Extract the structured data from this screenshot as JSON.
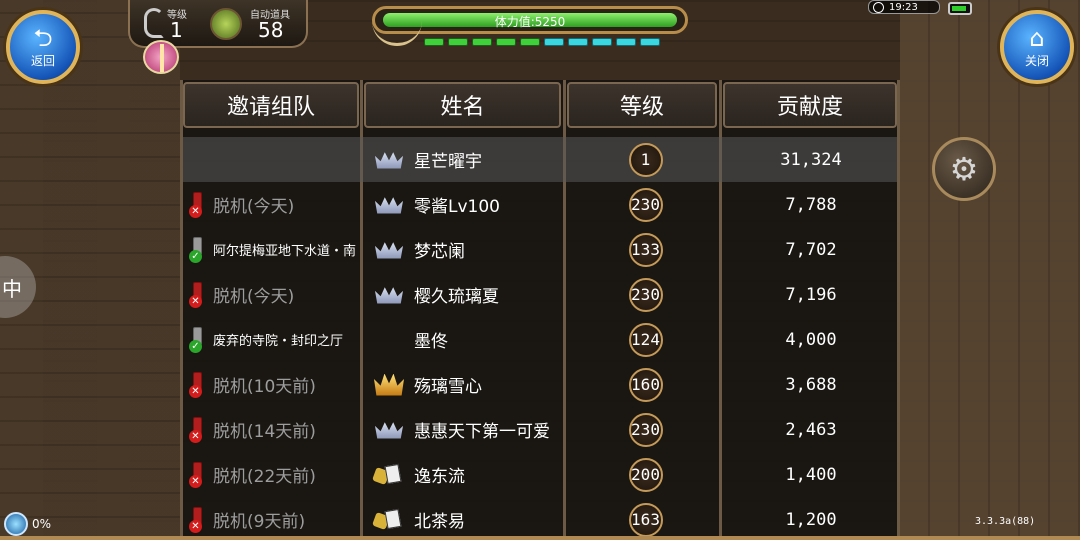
{
  "hud": {
    "level_label": "等级",
    "level_value": "1",
    "auto_item_label": "自动道具",
    "auto_item_value": "58",
    "stamina_text": "体力值:5250",
    "stamina_percent": 100,
    "energy_segments": {
      "green": 5,
      "cyan": 5
    },
    "clock": "19:23"
  },
  "buttons": {
    "back_label": "返回",
    "back_icon": "return-arrow-icon",
    "close_label": "关闭",
    "close_icon": "home-icon",
    "settings_icon": "gear-icon",
    "side_tab_glyph": "中"
  },
  "table": {
    "headers": {
      "status": "邀请组队",
      "name": "姓名",
      "level": "等级",
      "contribution": "贡献度"
    },
    "rows": [
      {
        "status": "",
        "online": null,
        "rank": "silver-crown-icon",
        "name": "星芒曜宇",
        "level": "1",
        "contribution": "31,324",
        "highlight": true
      },
      {
        "status": "脱机(今天)",
        "online": false,
        "rank": "silver-crown-icon",
        "name": "零酱Lv100",
        "level": "230",
        "contribution": "7,788"
      },
      {
        "status": "阿尔提梅亚地下水道・南",
        "online": true,
        "rank": "silver-crown-icon",
        "name": "梦芯阑",
        "level": "133",
        "contribution": "7,702"
      },
      {
        "status": "脱机(今天)",
        "online": false,
        "rank": "silver-crown-icon",
        "name": "樱久琉璃夏",
        "level": "230",
        "contribution": "7,196"
      },
      {
        "status": "废弃的寺院・封印之厅",
        "online": true,
        "rank": "",
        "name": "墨佟",
        "level": "124",
        "contribution": "4,000"
      },
      {
        "status": "脱机(10天前)",
        "online": false,
        "rank": "gold-crown-icon",
        "name": "殇璃雪心",
        "level": "160",
        "contribution": "3,688"
      },
      {
        "status": "脱机(14天前)",
        "online": false,
        "rank": "silver-crown-icon",
        "name": "惠惠天下第一可爱",
        "level": "230",
        "contribution": "2,463"
      },
      {
        "status": "脱机(22天前)",
        "online": false,
        "rank": "tools-icon",
        "name": "逸东流",
        "level": "200",
        "contribution": "1,400"
      },
      {
        "status": "脱机(9天前)",
        "online": false,
        "rank": "tools-icon",
        "name": "北茶易",
        "level": "163",
        "contribution": "1,200"
      }
    ]
  },
  "footer": {
    "percent": "0%",
    "version": "3.3.3a(88)"
  }
}
